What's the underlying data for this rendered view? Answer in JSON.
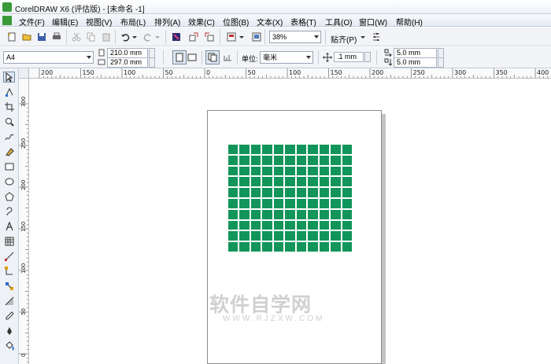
{
  "window": {
    "title": "CorelDRAW X6 (评估版) - [未命名 -1]"
  },
  "menu": {
    "items": [
      "文件(F)",
      "编辑(E)",
      "视图(V)",
      "布局(L)",
      "排列(A)",
      "效果(C)",
      "位图(B)",
      "文本(X)",
      "表格(T)",
      "工具(O)",
      "窗口(W)",
      "帮助(H)"
    ]
  },
  "standard_toolbar": {
    "zoom_value": "38%",
    "snap_label": "贴齐(P)"
  },
  "property_bar": {
    "page_size": "A4",
    "width": "210.0 mm",
    "height": "297.0 mm",
    "unit_label": "单位:",
    "unit_value": "毫米",
    "nudge": ".1 mm",
    "dup_x": "5.0 mm",
    "dup_y": "5.0 mm"
  },
  "ruler_top": {
    "labels": [
      "200",
      "150",
      "100",
      "50",
      "0",
      "50",
      "100",
      "150",
      "200",
      "250",
      "300",
      "350",
      "400"
    ]
  },
  "ruler_left": {
    "labels": [
      "300",
      "250",
      "200",
      "150",
      "100",
      "50",
      "0"
    ]
  },
  "document": {
    "grid_rows": 10,
    "grid_columns": 11,
    "fill_color": "#12955a"
  },
  "watermark": {
    "main": "软件自学网",
    "sub": "WWW.RJZXW.COM"
  },
  "colors": {
    "title_bg": "#eef1f6",
    "toolbar_bg": "#f2f4f7",
    "accent_green": "#12955a"
  }
}
